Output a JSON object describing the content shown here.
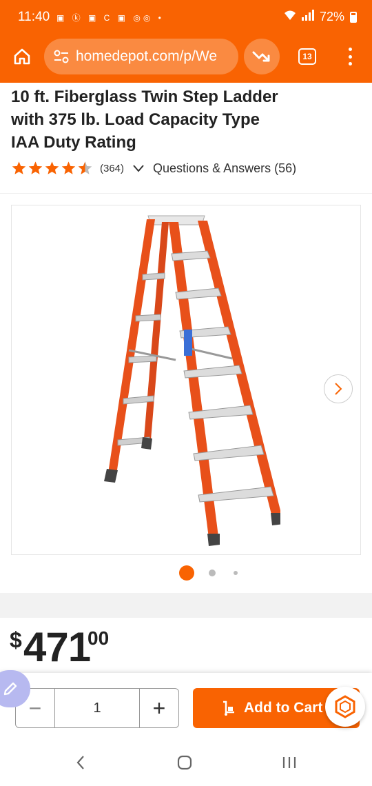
{
  "status_bar": {
    "time": "11:40",
    "battery": "72%"
  },
  "browser": {
    "url": "homedepot.com/p/We",
    "tab_count": "13"
  },
  "product": {
    "title_lines": [
      "10 ft. Fiberglass Twin Step Ladder",
      "with 375 lb. Load Capacity Type",
      "IAA Duty Rating"
    ],
    "rating": 4.5,
    "review_count": "(364)",
    "qa_label": "Questions & Answers (56)"
  },
  "gallery": {
    "image_count": 3,
    "active_index": 0
  },
  "price": {
    "currency": "$",
    "whole": "471",
    "cents": "00"
  },
  "cart": {
    "quantity": "1",
    "minus_label": "−",
    "plus_label": "+",
    "add_to_cart_label": "Add to Cart"
  },
  "colors": {
    "brand_orange": "#f96302",
    "star": "#f96302"
  },
  "icons": {
    "home": "home-icon",
    "site_settings": "tune-icon",
    "trend": "trending-down-icon",
    "menu": "more-vert-icon",
    "next": "chevron-right-icon",
    "cart": "dolly-icon",
    "chat": "chat-hex-icon",
    "edit": "pencil-icon"
  }
}
